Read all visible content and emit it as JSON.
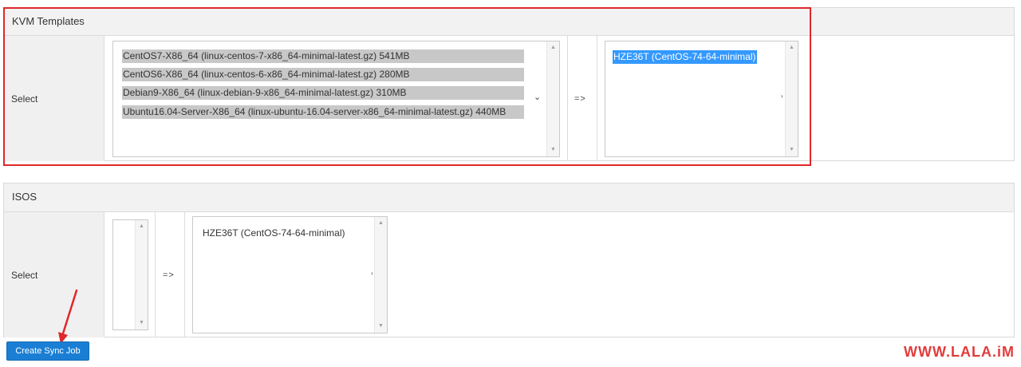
{
  "kvm": {
    "title": "KVM Templates",
    "row_label": "Select",
    "source_options": [
      "CentOS7-X86_64 (linux-centos-7-x86_64-minimal-latest.gz) 541MB",
      "CentOS6-X86_64 (linux-centos-6-x86_64-minimal-latest.gz) 280MB",
      "Debian9-X86_64 (linux-debian-9-x86_64-minimal-latest.gz) 310MB",
      "Ubuntu16.04-Server-X86_64 (linux-ubuntu-16.04-server-x86_64-minimal-latest.gz) 440MB"
    ],
    "arrow": "=>",
    "target_options": [
      "HZE36T (CentOS-74-64-minimal)"
    ]
  },
  "isos": {
    "title": "ISOS",
    "row_label": "Select",
    "arrow": "=>",
    "target_options": [
      "HZE36T (CentOS-74-64-minimal)"
    ]
  },
  "create_button": "Create Sync Job",
  "watermark": "WWW.LALA.iM",
  "colors": {
    "highlight_box": "#e0272a",
    "selected_option": "#3399ff",
    "button": "#1a7fd4",
    "watermark": "#e23b3b"
  }
}
